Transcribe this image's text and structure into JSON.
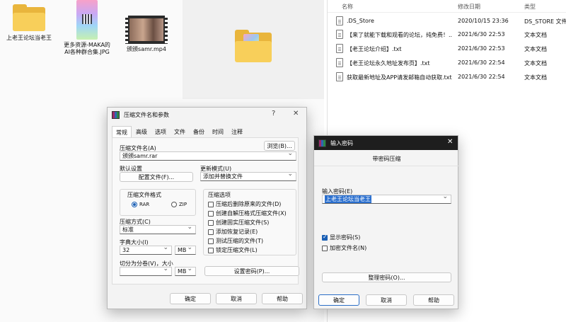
{
  "desktop": {
    "items": [
      {
        "label": "上老王论坛当老王"
      },
      {
        "label": "更多资源-MAKA的AI各种群合集.JPG"
      },
      {
        "label": "颁颁samr.mp4"
      }
    ]
  },
  "explorer": {
    "headers": {
      "name": "名称",
      "date": "修改日期",
      "type": "类型"
    },
    "rows": [
      {
        "name": ".DS_Store",
        "date": "2020/10/15 23:36",
        "type": "DS_STORE 文件"
      },
      {
        "name": "【来了就能下载和观看的论坛，纯免费！...",
        "date": "2021/6/30 22:53",
        "type": "文本文档"
      },
      {
        "name": "【老王论坛介绍】.txt",
        "date": "2021/6/30 22:53",
        "type": "文本文档"
      },
      {
        "name": "【老王论坛永久地址发布页】.txt",
        "date": "2021/6/30 22:54",
        "type": "文本文档"
      },
      {
        "name": "获取最新地址及APP请发邮箱自动获取.txt",
        "date": "2021/6/30 22:54",
        "type": "文本文档"
      }
    ]
  },
  "archive_dialog": {
    "title": "压缩文件名和参数",
    "help_glyph": "?",
    "close_glyph": "✕",
    "tabs": [
      "常规",
      "高级",
      "选项",
      "文件",
      "备份",
      "时间",
      "注释"
    ],
    "archive_name_label": "压缩文件名(A)",
    "archive_name_value": "颁颁samr.rar",
    "browse_label": "浏览(B)...",
    "default_settings_label": "默认设置",
    "profiles_label": "配置文件(F)...",
    "update_mode_label": "更新模式(U)",
    "update_mode_value": "添加并替换文件",
    "format_label": "压缩文件格式",
    "format_rar": "RAR",
    "format_zip": "ZIP",
    "options_label": "压缩选项",
    "options": [
      {
        "label": "压缩后删除原来的文件(D)",
        "checked": false
      },
      {
        "label": "创建自解压格式压缩文件(X)",
        "checked": false
      },
      {
        "label": "创建固实压缩文件(S)",
        "checked": false
      },
      {
        "label": "添加恢复记录(E)",
        "checked": false
      },
      {
        "label": "测试压缩的文件(T)",
        "checked": false
      },
      {
        "label": "锁定压缩文件(L)",
        "checked": false
      }
    ],
    "method_label": "压缩方式(C)",
    "method_value": "标准",
    "dict_label": "字典大小(I)",
    "dict_value": "32",
    "dict_unit": "MB",
    "split_label": "切分为分卷(V)，大小",
    "split_value": "",
    "split_unit": "MB",
    "set_password_label": "设置密码(P)...",
    "ok_label": "确定",
    "cancel_label": "取消",
    "help_label": "帮助"
  },
  "password_dialog": {
    "title": "输入密码",
    "close_glyph": "✕",
    "subtitle": "带密码压缩",
    "password_label": "输入密码(E)",
    "password_value": "上老王论坛当老王",
    "show_password_label": "显示密码(S)",
    "show_password_checked": true,
    "encrypt_names_label": "加密文件名(N)",
    "encrypt_names_checked": false,
    "organize_label": "整理密码(O)...",
    "ok_label": "确定",
    "cancel_label": "取消",
    "help_label": "帮助"
  }
}
